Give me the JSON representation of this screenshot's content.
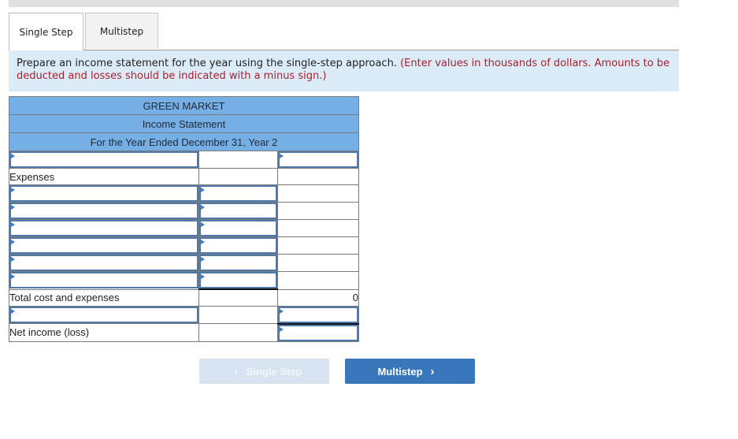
{
  "tabs": [
    {
      "label": "Single Step",
      "active": true
    },
    {
      "label": "Multistep",
      "active": false
    }
  ],
  "instructions": {
    "main": "Prepare an income statement for the year using the single-step approach.",
    "note": "(Enter values in thousands of dollars. Amounts to be deducted and losses should be indicated with a minus sign.)"
  },
  "statement": {
    "company": "GREEN MARKET",
    "title": "Income Statement",
    "period": "For the Year Ended December 31, Year 2",
    "expenses_label": "Expenses",
    "total_label": "Total cost and expenses",
    "total_value": "0",
    "net_income_label": "Net income (loss)"
  },
  "buttons": {
    "prev_label": "Single Step",
    "next_label": "Multistep",
    "prev_icon": "chevron-left-icon",
    "next_icon": "chevron-right-icon"
  },
  "colors": {
    "header_bg": "#76aee6",
    "instruction_bg": "#dcebf8",
    "note_red": "#a8212b",
    "next_button": "#3a76bb",
    "prev_button_disabled": "#d7e3f1"
  }
}
